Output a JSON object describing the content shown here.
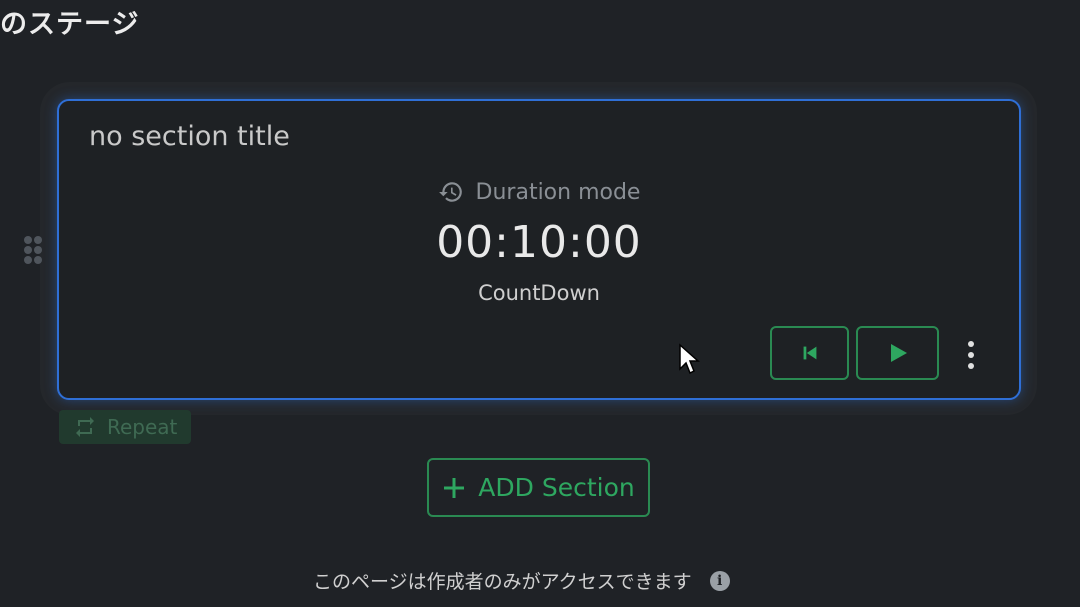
{
  "page": {
    "title": "のステージ"
  },
  "section": {
    "title": "no section title",
    "mode_label": "Duration mode",
    "time": "00:10:00",
    "type": "CountDown"
  },
  "controls": {
    "repeat_label": "Repeat",
    "add_section_label": "ADD Section"
  },
  "footer": {
    "access_note": "このページは作成者のみがアクセスできます",
    "info_symbol": "i"
  },
  "colors": {
    "background": "#1f2226",
    "card_border": "#2f6fd6",
    "accent_green": "#2ea760",
    "muted_text": "#8a8f95"
  },
  "icons": {
    "mode": "history-icon",
    "prev": "skip-previous-icon",
    "play": "play-icon",
    "more": "more-vert-icon",
    "repeat": "repeat-icon",
    "add": "plus-icon",
    "info": "info-icon",
    "drag": "drag-handle-icon"
  }
}
